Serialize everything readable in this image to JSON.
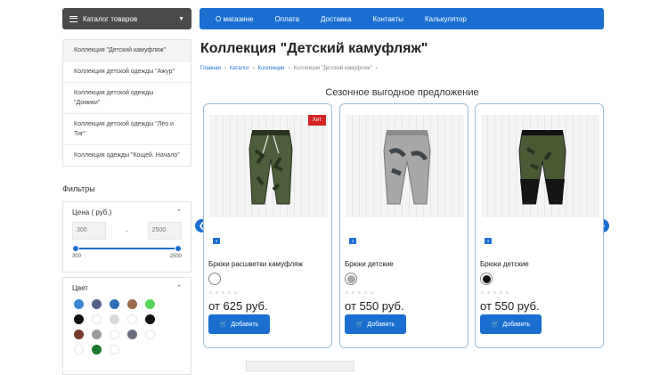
{
  "header": {
    "catalog_label": "Каталог товаров",
    "nav": [
      "О магазине",
      "Оплата",
      "Доставка",
      "Контакты",
      "Калькулятор"
    ]
  },
  "sidebar": {
    "collections": [
      "Коллекция \"Детский камуфляж\"",
      "Коллекция детской одежды \"Ажур\"",
      "Коллекция детской одежды \"Домики\"",
      "Коллекция детской одежды \"Лео и Тиг\"",
      "Коллекция одежды \"Кощей. Начало\""
    ],
    "filters_title": "Фильтры",
    "price": {
      "title": "Цена ( руб.)",
      "min_placeholder": "300",
      "max_placeholder": "2500",
      "separator": "-",
      "range_min": "300",
      "range_max": "2500"
    },
    "color": {
      "title": "Цвет",
      "swatches": [
        "#3a87d6",
        "#555f8a",
        "#2a6fb8",
        "#9b6a4a",
        "#56d656",
        "#111111",
        "#ffffff",
        "#d8d8d8",
        "#ffffff",
        "#111111",
        "#7a3a2a",
        "#9a9a9a",
        "#ffffff",
        "#6c6f80",
        "#ffffff",
        "#ffffff",
        "#1b7a2b",
        "#ffffff"
      ]
    }
  },
  "main": {
    "title": "Коллекция \"Детский камуфляж\"",
    "breadcrumb": [
      "Главная",
      "Каталог",
      "Коллекции",
      "Коллекция \"Детский камуфляж\""
    ],
    "section_title": "Сезонное выгодное предложение",
    "products": [
      {
        "name": "Брюки расшветки камуфляж",
        "price": "от 625 руб.",
        "badge": "Хит",
        "button": "Добавить",
        "color": "#ffffff",
        "badge_num": "3"
      },
      {
        "name": "Брюки детские",
        "price": "от 550 руб.",
        "badge": "",
        "button": "Добавить",
        "color": "#a8a8a8",
        "badge_num": "3"
      },
      {
        "name": "Брюки детские",
        "price": "от 550 руб.",
        "badge": "",
        "button": "Добавить",
        "color": "#111111",
        "badge_num": "3"
      }
    ]
  }
}
